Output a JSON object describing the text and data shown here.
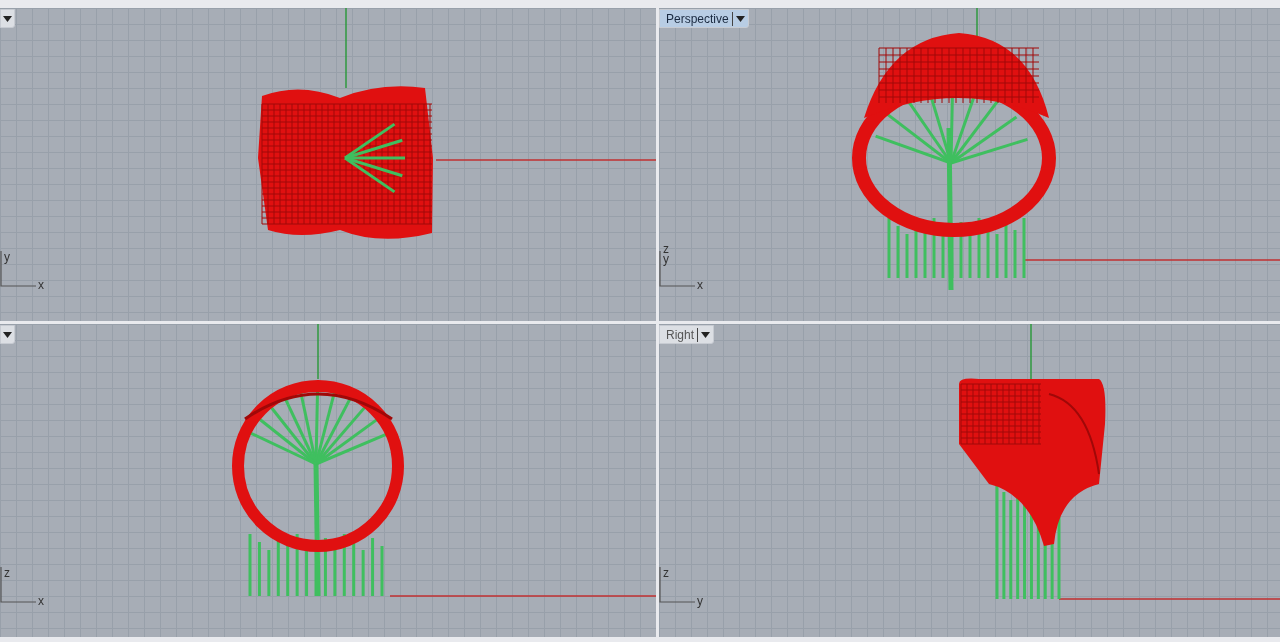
{
  "viewports": [
    {
      "kind": "top",
      "active": false,
      "axis_labels": [
        "y",
        "x"
      ]
    },
    {
      "kind": "perspective",
      "label": "Perspective",
      "active": true,
      "axis_labels": [
        "z",
        "y",
        "x"
      ]
    },
    {
      "kind": "front",
      "active": false,
      "axis_labels": [
        "z",
        "x"
      ]
    },
    {
      "kind": "right",
      "label": "Right",
      "active": false,
      "axis_labels": [
        "z",
        "y"
      ]
    }
  ]
}
